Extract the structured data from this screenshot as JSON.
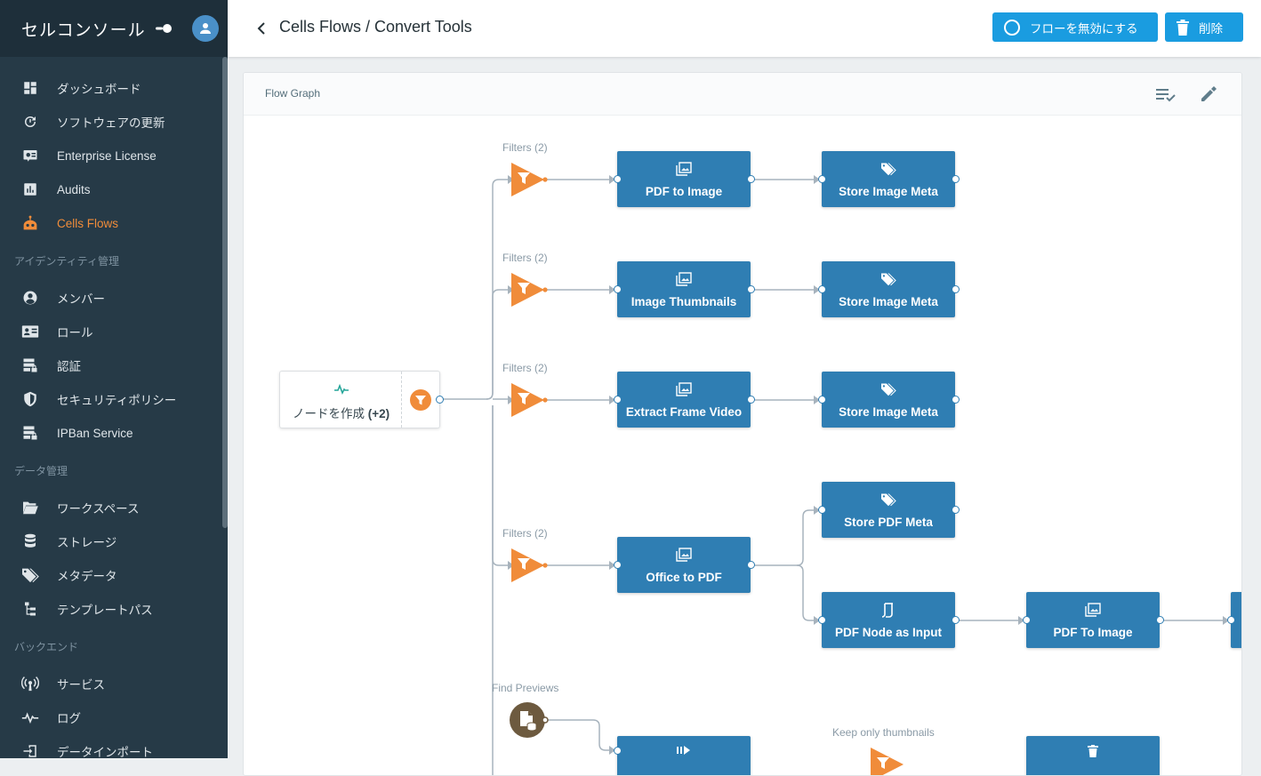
{
  "app": {
    "brand": "セルコンソール"
  },
  "colors": {
    "sidebar": "#263a47",
    "accent": "#f08c3a",
    "node": "#2f7eb3",
    "primary_button": "#1a9ce0"
  },
  "sidebar": {
    "items": [
      {
        "label": "ダッシュボード",
        "icon": "dashboard-icon",
        "active": false
      },
      {
        "label": "ソフトウェアの更新",
        "icon": "update-icon",
        "active": false
      },
      {
        "label": "Enterprise License",
        "icon": "license-icon",
        "active": false
      },
      {
        "label": "Audits",
        "icon": "chart-icon",
        "active": false
      },
      {
        "label": "Cells Flows",
        "icon": "robot-icon",
        "active": true
      }
    ],
    "section_identity": "アイデンティティ管理",
    "identity_items": [
      {
        "label": "メンバー",
        "icon": "user-circle-icon"
      },
      {
        "label": "ロール",
        "icon": "id-card-icon"
      },
      {
        "label": "認証",
        "icon": "server-lock-icon"
      },
      {
        "label": "セキュリティポリシー",
        "icon": "shield-icon"
      },
      {
        "label": "IPBan Service",
        "icon": "server-lock-icon"
      }
    ],
    "section_data": "データ管理",
    "data_items": [
      {
        "label": "ワークスペース",
        "icon": "folder-open-icon"
      },
      {
        "label": "ストレージ",
        "icon": "database-icon"
      },
      {
        "label": "メタデータ",
        "icon": "tags-icon"
      },
      {
        "label": "テンプレートパス",
        "icon": "file-tree-icon"
      }
    ],
    "section_backend": "バックエンド",
    "backend_items": [
      {
        "label": "サービス",
        "icon": "access-point-icon"
      },
      {
        "label": "ログ",
        "icon": "pulse-icon"
      },
      {
        "label": "データインポート",
        "icon": "import-icon"
      }
    ]
  },
  "header": {
    "title": "Cells Flows / Convert Tools",
    "disable_label": "フローを無効にする",
    "delete_label": "削除"
  },
  "card": {
    "title": "Flow Graph"
  },
  "graph": {
    "start_label": "ノードを作成",
    "start_count": "(+2)",
    "filter_labels": [
      "Filters (2)",
      "Filters (2)",
      "Filters (2)",
      "Filters (2)"
    ],
    "find_label": "Find Previews",
    "keep_label": "Keep only thumbnails",
    "nodes": [
      {
        "label": "PDF to Image",
        "icon": "image-multiple-icon"
      },
      {
        "label": "Store Image Meta",
        "icon": "tags-icon"
      },
      {
        "label": "Image Thumbnails",
        "icon": "image-multiple-icon"
      },
      {
        "label": "Store Image Meta",
        "icon": "tags-icon"
      },
      {
        "label": "Extract Frame Video",
        "icon": "image-multiple-icon"
      },
      {
        "label": "Store Image Meta",
        "icon": "tags-icon"
      },
      {
        "label": "Store PDF Meta",
        "icon": "tags-icon"
      },
      {
        "label": "Office to PDF",
        "icon": "image-multiple-icon"
      },
      {
        "label": "PDF Node as Input",
        "icon": "swap-icon"
      },
      {
        "label": "PDF To Image",
        "icon": "image-multiple-icon"
      },
      {
        "label": "",
        "icon": "video-icon"
      },
      {
        "label": "",
        "icon": "delete-icon"
      }
    ]
  }
}
